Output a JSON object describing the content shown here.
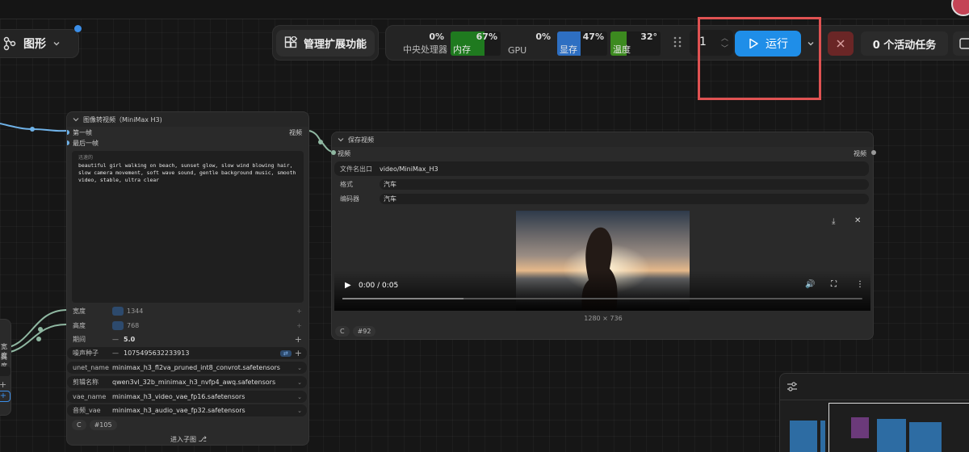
{
  "header": {
    "graph_label": "图形",
    "extensions_label": "管理扩展功能"
  },
  "stats": {
    "cpu": {
      "value": "0%",
      "label": "中央处理器",
      "fraction": 0.0
    },
    "ram": {
      "value": "67%",
      "label": "内存",
      "fraction": 0.67,
      "color": "#1f7a1f"
    },
    "gpu": {
      "value": "0%",
      "label": "GPU",
      "fraction": 0.0
    },
    "vram": {
      "value": "47%",
      "label": "显存",
      "fraction": 0.47,
      "color": "#2e6fc2"
    },
    "temp": {
      "value": "32°",
      "label": "温度",
      "fraction": 0.32,
      "color": "#3c8a1f"
    }
  },
  "queue": {
    "count": "1",
    "run_label": "运行",
    "tasks_label": "0 个活动任务"
  },
  "left_node": {
    "labels": [
      "宽度",
      "高度"
    ]
  },
  "i2v_node": {
    "title": "图像转视频（MiniMax H3)",
    "inputs": [
      "第一帧",
      "最后一帧"
    ],
    "output": "视频",
    "prompt_placeholder": "迅速的",
    "prompt": "beautiful girl walking on beach, sunset glow, slow wind blowing hair, slow camera movement, soft wave sound, gentle background music, smooth video, stable, ultra clear",
    "widgets": {
      "width": {
        "label": "宽度",
        "value": "1344"
      },
      "height": {
        "label": "高度",
        "value": "768"
      },
      "duration": {
        "label": "期间",
        "value": "5.0"
      },
      "seed": {
        "label": "噪声种子",
        "value": "1075495632233913"
      },
      "unet": {
        "label": "unet_name",
        "value": "minimax_h3_fl2va_pruned_int8_convrot.safetensors"
      },
      "clip": {
        "label": "剪辑名称",
        "value": "qwen3vl_32b_minimax_h3_nvfp4_awq.safetensors"
      },
      "vae": {
        "label": "vae_name",
        "value": "minimax_h3_video_vae_fp16.safetensors"
      },
      "audio_vae": {
        "label": "音频_vae",
        "value": "minimax_h3_audio_vae_fp32.safetensors"
      }
    },
    "node_id": "#105",
    "subgraph_label": "进入子图"
  },
  "save_node": {
    "title": "保存视频",
    "input": "视频",
    "output": "视频",
    "widgets": {
      "prefix": {
        "label": "文件名出口",
        "value": "video/MiniMax_H3"
      },
      "format": {
        "label": "格式",
        "value": "汽车"
      },
      "codec": {
        "label": "编码器",
        "value": "汽车"
      }
    },
    "video": {
      "time": "0:00 / 0:05",
      "resolution": "1280 × 736",
      "progress": 0.0
    },
    "node_id": "#92"
  }
}
